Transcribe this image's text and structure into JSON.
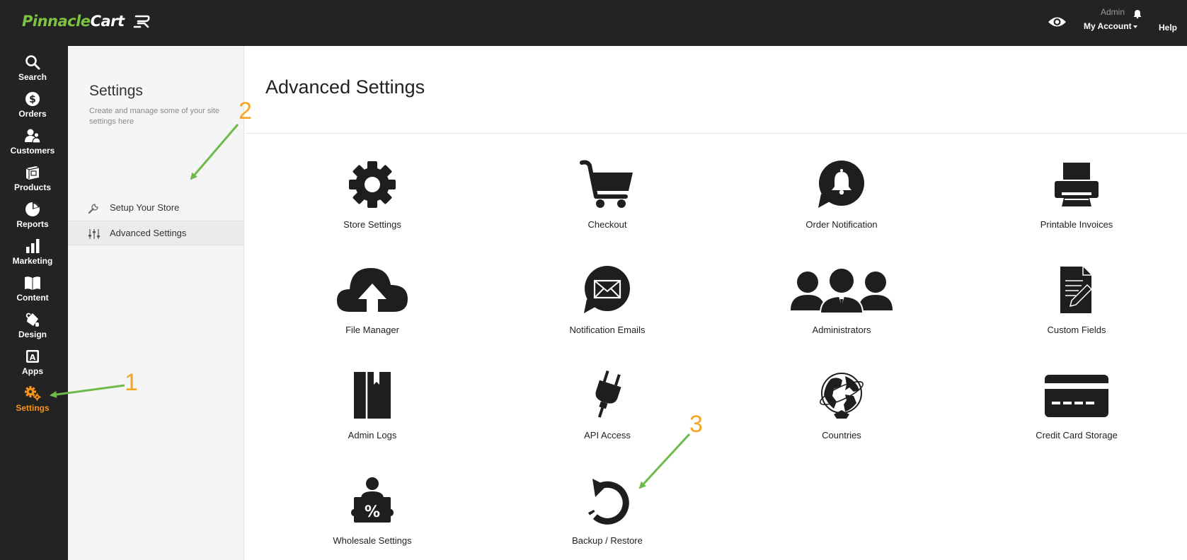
{
  "brand": {
    "logo_green": "Pinnacle",
    "logo_white": "Cart"
  },
  "topbar": {
    "user": "Admin",
    "account": "My Account",
    "help": "Help"
  },
  "sidenav": {
    "items": [
      {
        "label": "Search",
        "icon": "search-icon"
      },
      {
        "label": "Orders",
        "icon": "dollar-circle-icon"
      },
      {
        "label": "Customers",
        "icon": "users-icon"
      },
      {
        "label": "Products",
        "icon": "box-icon"
      },
      {
        "label": "Reports",
        "icon": "pie-chart-icon"
      },
      {
        "label": "Marketing",
        "icon": "bar-chart-icon"
      },
      {
        "label": "Content",
        "icon": "book-icon"
      },
      {
        "label": "Design",
        "icon": "paint-bucket-icon"
      },
      {
        "label": "Apps",
        "icon": "app-icon"
      },
      {
        "label": "Settings",
        "icon": "gears-icon",
        "active": true
      }
    ]
  },
  "subpanel": {
    "title": "Settings",
    "description": "Create and manage some of your site settings here",
    "items": [
      {
        "label": "Setup Your Store",
        "icon": "wrench-icon"
      },
      {
        "label": "Advanced Settings",
        "icon": "sliders-icon",
        "active": true
      }
    ]
  },
  "main": {
    "title": "Advanced Settings",
    "tiles": [
      {
        "label": "Store Settings",
        "icon": "gear-icon"
      },
      {
        "label": "Checkout",
        "icon": "cart-icon"
      },
      {
        "label": "Order Notification",
        "icon": "bell-bubble-icon"
      },
      {
        "label": "Printable Invoices",
        "icon": "printer-icon"
      },
      {
        "label": "File Manager",
        "icon": "cloud-upload-icon"
      },
      {
        "label": "Notification Emails",
        "icon": "envelope-bubble-icon"
      },
      {
        "label": "Administrators",
        "icon": "people-icon"
      },
      {
        "label": "Custom Fields",
        "icon": "document-pen-icon"
      },
      {
        "label": "Admin Logs",
        "icon": "logbook-icon"
      },
      {
        "label": "API Access",
        "icon": "plug-icon"
      },
      {
        "label": "Countries",
        "icon": "globe-icon"
      },
      {
        "label": "Credit Card Storage",
        "icon": "credit-card-icon"
      },
      {
        "label": "Wholesale Settings",
        "icon": "wholesale-person-icon"
      },
      {
        "label": "Backup / Restore",
        "icon": "restore-icon"
      }
    ]
  },
  "annotations": {
    "step1": "1",
    "step2": "2",
    "step3": "3"
  },
  "colors": {
    "accent_green": "#7dc242",
    "active_orange": "#f7941d",
    "annotation_orange": "#f5a623",
    "arrow_green": "#6dbb4a",
    "dark_bg": "#232323"
  }
}
